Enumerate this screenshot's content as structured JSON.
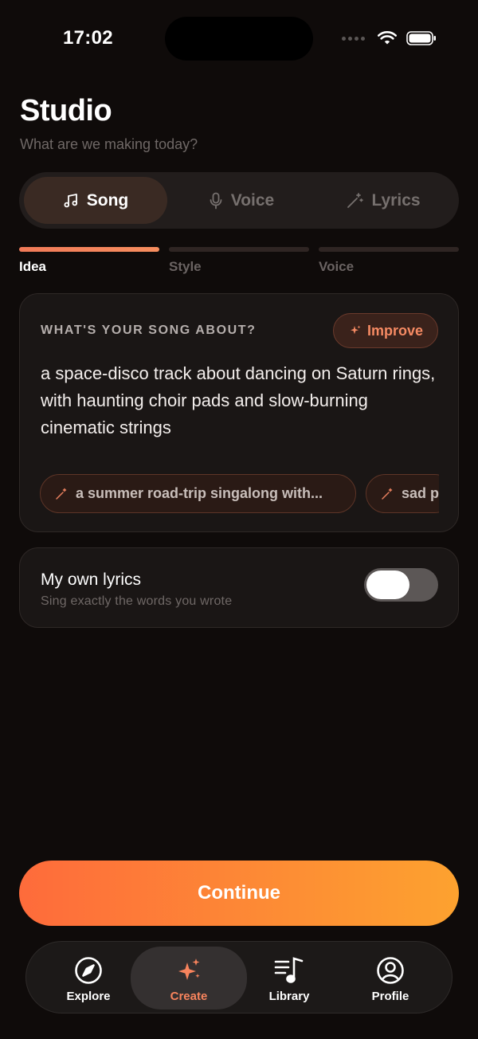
{
  "status_bar": {
    "time": "17:02",
    "icons": [
      "signal-dots-icon",
      "wifi-icon",
      "battery-icon"
    ]
  },
  "header": {
    "title": "Studio",
    "subtitle": "What are we making today?"
  },
  "mode_tabs": [
    {
      "label": "Song",
      "icon": "music-note-icon",
      "active": true
    },
    {
      "label": "Voice",
      "icon": "microphone-icon",
      "active": false
    },
    {
      "label": "Lyrics",
      "icon": "magic-wand-icon",
      "active": false
    }
  ],
  "steps": [
    {
      "label": "Idea",
      "active": true
    },
    {
      "label": "Style",
      "active": false
    },
    {
      "label": "Voice",
      "active": false
    }
  ],
  "idea_card": {
    "heading": "WHAT'S YOUR SONG ABOUT?",
    "improve_label": "Improve",
    "text": "a space-disco track about dancing on Saturn rings, with haunting choir pads and slow-burning cinematic strings",
    "suggestions": [
      "a summer road-trip singalong with...",
      "sad p"
    ]
  },
  "lyrics_option": {
    "title": "My own lyrics",
    "subtitle": "Sing exactly the words you wrote",
    "enabled": false
  },
  "continue_label": "Continue",
  "tab_bar": [
    {
      "label": "Explore",
      "icon": "compass-icon",
      "active": false
    },
    {
      "label": "Create",
      "icon": "sparkles-icon",
      "active": true
    },
    {
      "label": "Library",
      "icon": "library-icon",
      "active": false
    },
    {
      "label": "Profile",
      "icon": "profile-icon",
      "active": false
    }
  ],
  "colors": {
    "background": "#0f0b0a",
    "accent": "#f58a63",
    "continue_start": "#fe6b3b",
    "continue_end": "#fda22f"
  }
}
